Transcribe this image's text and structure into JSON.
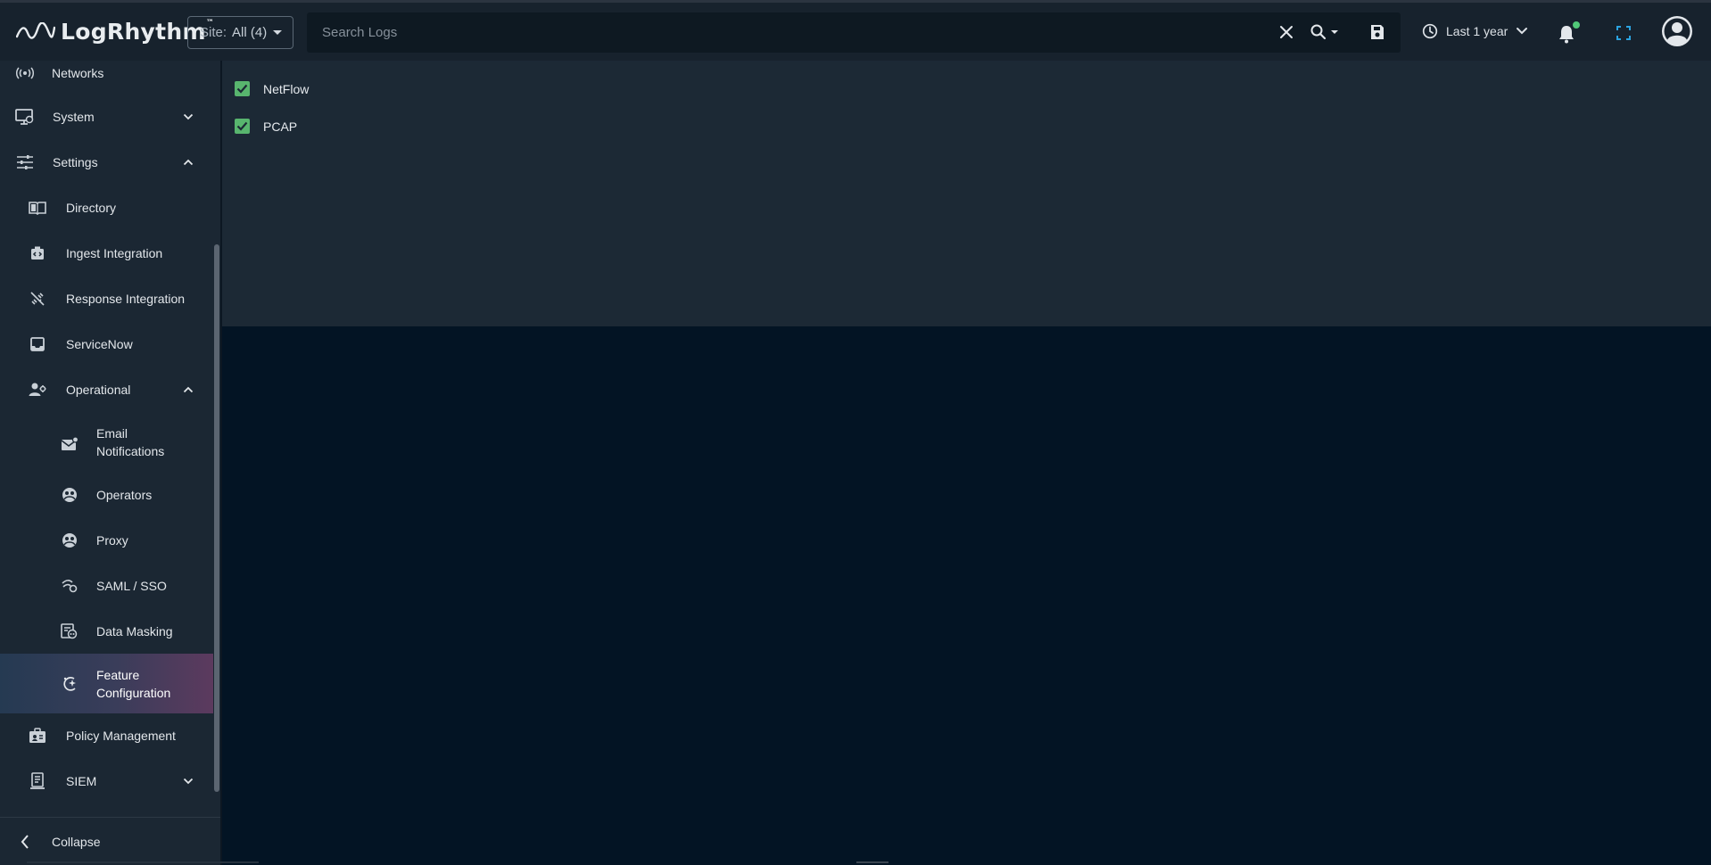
{
  "header": {
    "logo_text": "LogRhythm",
    "logo_tm": "™",
    "site_label": "Site:",
    "site_value": "All (4)",
    "search_placeholder": "Search Logs",
    "search_value": "",
    "time_range": "Last 1 year",
    "accent_color": "#2ba3e0",
    "notification_dot_color": "#51c878"
  },
  "sidebar": {
    "items": [
      {
        "label": "Networks",
        "icon": "networks-icon"
      },
      {
        "label": "System",
        "icon": "system-icon",
        "expanded": false
      },
      {
        "label": "Settings",
        "icon": "settings-icon",
        "expanded": true
      },
      {
        "label": "Directory",
        "icon": "directory-icon"
      },
      {
        "label": "Ingest Integration",
        "icon": "ingest-integration-icon"
      },
      {
        "label": "Response Integration",
        "icon": "response-integration-icon"
      },
      {
        "label": "ServiceNow",
        "icon": "servicenow-icon"
      },
      {
        "label": "Operational",
        "icon": "operational-icon",
        "expanded": true
      },
      {
        "label_line1": "Email",
        "label_line2": "Notifications",
        "icon": "email-notifications-icon"
      },
      {
        "label": "Operators",
        "icon": "operators-icon"
      },
      {
        "label": "Proxy",
        "icon": "proxy-icon"
      },
      {
        "label": "SAML / SSO",
        "icon": "saml-sso-icon"
      },
      {
        "label": "Data Masking",
        "icon": "data-masking-icon"
      },
      {
        "label_line1": "Feature",
        "label_line2": "Configuration",
        "icon": "feature-configuration-icon",
        "active": true
      },
      {
        "label": "Policy Management",
        "icon": "policy-management-icon"
      },
      {
        "label": "SIEM",
        "icon": "siem-icon",
        "expanded": false
      }
    ],
    "collapse_label": "Collapse"
  },
  "main": {
    "checkboxes": [
      {
        "label": "NetFlow",
        "checked": true
      },
      {
        "label": "PCAP",
        "checked": true
      }
    ],
    "checkbox_color": "#58b56e"
  }
}
